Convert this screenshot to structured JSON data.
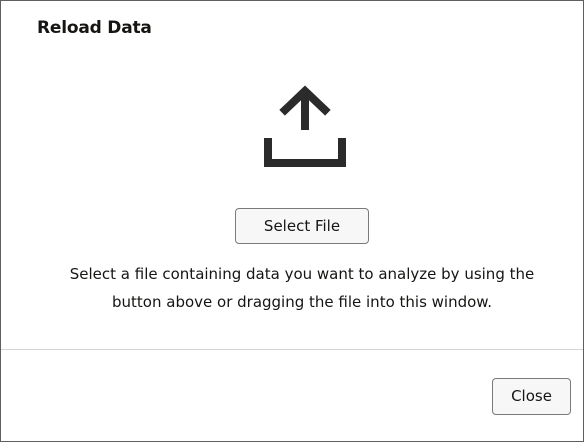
{
  "dialog": {
    "title": "Reload Data",
    "icon": "upload-icon",
    "select_file_label": "Select File",
    "description": "Select a file containing data you want to analyze by using the button above or dragging the file into this window.",
    "close_label": "Close"
  },
  "colors": {
    "text": "#161513",
    "icon": "#2b2b2b",
    "button_border": "#7a7a7a",
    "button_bg": "#f7f7f7",
    "divider": "#d4d4d4"
  }
}
